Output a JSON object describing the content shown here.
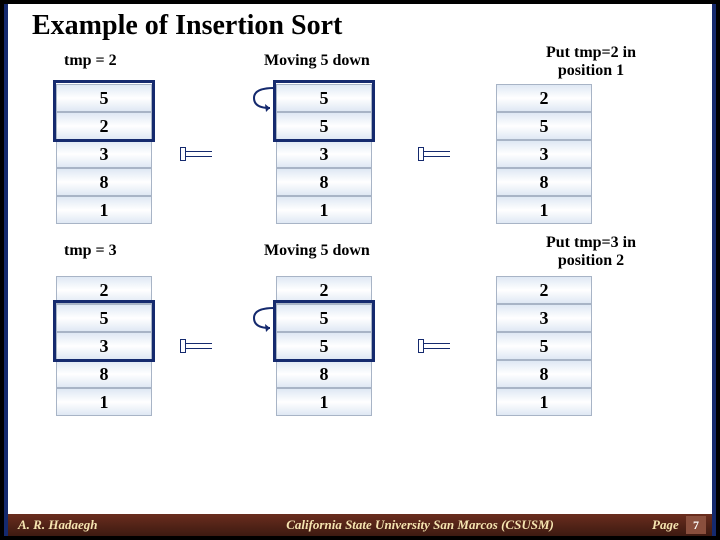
{
  "title": "Example of Insertion Sort",
  "labels": {
    "tmp2": "tmp = 2",
    "move5a": "Moving 5 down",
    "put2": "Put tmp=2 in\nposition 1",
    "tmp3": "tmp = 3",
    "move5b": "Moving 5 down",
    "put3": "Put tmp=3 in\nposition 2"
  },
  "columns": {
    "r1c1": [
      "5",
      "2",
      "3",
      "8",
      "1"
    ],
    "r1c2": [
      "5",
      "5",
      "3",
      "8",
      "1"
    ],
    "r1c3": [
      "2",
      "5",
      "3",
      "8",
      "1"
    ],
    "r2c1": [
      "2",
      "5",
      "3",
      "8",
      "1"
    ],
    "r2c2": [
      "2",
      "5",
      "5",
      "8",
      "1"
    ],
    "r2c3": [
      "2",
      "3",
      "5",
      "8",
      "1"
    ]
  },
  "footer": {
    "author": "A. R. Hadaegh",
    "univ": "California State University San Marcos (CSUSM)",
    "page_label": "Page",
    "page_num": "7"
  }
}
